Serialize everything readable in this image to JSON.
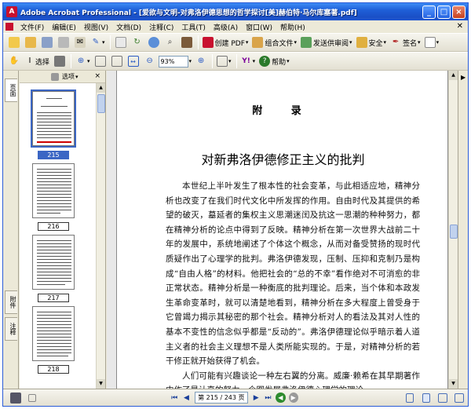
{
  "window": {
    "title": "Adobe Acrobat Professional - [爱欲与文明-对弗洛伊德思想的哲学探讨[美]赫伯特·马尔库塞著.pdf]",
    "controls": [
      "_",
      "□",
      "×"
    ]
  },
  "menu": {
    "items": [
      "文件(F)",
      "编辑(E)",
      "视图(V)",
      "文档(D)",
      "注释(C)",
      "工具(T)",
      "高级(A)",
      "窗口(W)",
      "帮助(H)"
    ]
  },
  "toolbar1": {
    "create_pdf": "创建 PDF",
    "combine": "组合文件",
    "send_review": "发送供审阅",
    "secure": "安全",
    "sign": "签名"
  },
  "toolbar2": {
    "select": "选择",
    "zoom_value": "93%",
    "help": "帮助"
  },
  "left_tabs": [
    "页面",
    "附件",
    "注释"
  ],
  "pages_panel": {
    "options_label": "选项",
    "close": "×",
    "thumbnails": [
      {
        "label": "215",
        "selected": true
      },
      {
        "label": "216",
        "selected": false
      },
      {
        "label": "217",
        "selected": false
      },
      {
        "label": "218",
        "selected": false
      }
    ]
  },
  "document": {
    "appendix": "附 录",
    "chapter_title": "对新弗洛伊德修正主义的批判",
    "paragraphs": [
      "本世纪上半叶发生了根本性的社会变革，与此相适应地，精神分析也改变了在我们时代文化中所发挥的作用。自由时代及其提供的希望的破灭，墓延者的集权主义思潮迷闰及抗这一思潮的种种努力，都在精神分析的论点中得到了反映。精神分析在第一次世界大战前二十年的发展中，系统地阐述了个体这个概念，从而对备受赞扬的现时代质疑作出了心理学的批判。弗洛伊德发现，压制、压抑和克制乃是构成“自由人格”的材料。他把社会的“总的不幸”看作绝对不可消愈的非正常状态。精神分析是一种衡底的批判理论。后来，当个体和本政发生革命变革时，就可以清楚地看到，精神分析在多大程度上曾受身于它曾竭力揭示其秘密的那个社会。精神分析对人的看法及其对人性的基本不变性的信念似乎都是“反动的”。弗洛伊德理论似乎暗示着人道主义者的社会主义理想不是人类所能实现的。于是，对精神分析的若干修正就开始获得了机会。",
      "人们可能有兴趣谈论一种左右翼的分离。威廉·赖希在其早期著作中作了最认真的努力，企图发展弗洛伊德心理学的理论"
    ]
  },
  "statusbar": {
    "page_indicator": "第 215 / 243 页"
  }
}
